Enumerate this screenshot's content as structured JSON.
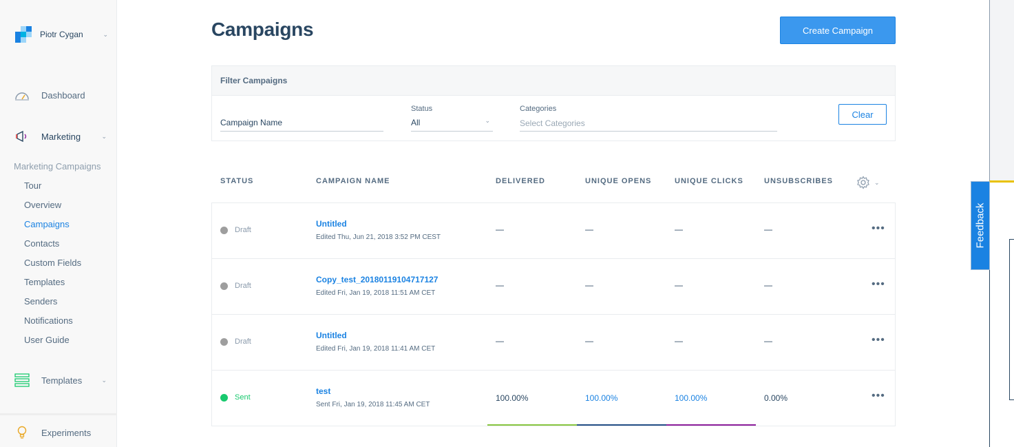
{
  "account": {
    "name": "Piotr Cygan"
  },
  "nav": {
    "dashboard": "Dashboard",
    "marketing": "Marketing",
    "templates": "Templates",
    "experiments": "Experiments"
  },
  "marketing_sub": {
    "heading": "Marketing Campaigns",
    "items": [
      "Tour",
      "Overview",
      "Campaigns",
      "Contacts",
      "Custom Fields",
      "Templates",
      "Senders",
      "Notifications",
      "User Guide"
    ],
    "active": "Campaigns"
  },
  "page": {
    "title": "Campaigns",
    "create_button": "Create Campaign"
  },
  "filter": {
    "heading": "Filter Campaigns",
    "campaign_name_placeholder": "Campaign Name",
    "status_label": "Status",
    "status_value": "All",
    "categories_label": "Categories",
    "categories_placeholder": "Select Categories",
    "clear_button": "Clear"
  },
  "table": {
    "columns": [
      "STATUS",
      "CAMPAIGN NAME",
      "DELIVERED",
      "UNIQUE OPENS",
      "UNIQUE CLICKS",
      "UNSUBSCRIBES"
    ],
    "rows": [
      {
        "status": "Draft",
        "name": "Untitled",
        "date": "Edited Thu, Jun 21, 2018 3:52 PM CEST",
        "delivered": "—",
        "opens": "—",
        "clicks": "—",
        "unsubs": "—"
      },
      {
        "status": "Draft",
        "name": "Copy_test_20180119104717127",
        "date": "Edited Fri, Jan 19, 2018 11:51 AM CET",
        "delivered": "—",
        "opens": "—",
        "clicks": "—",
        "unsubs": "—"
      },
      {
        "status": "Draft",
        "name": "Untitled",
        "date": "Edited Fri, Jan 19, 2018 11:41 AM CET",
        "delivered": "—",
        "opens": "—",
        "clicks": "—",
        "unsubs": "—"
      },
      {
        "status": "Sent",
        "name": "test",
        "date": "Sent Fri, Jan 19, 2018 11:45 AM CET",
        "delivered": "100.00%",
        "opens": "100.00%",
        "clicks": "100.00%",
        "unsubs": "0.00%"
      }
    ]
  },
  "feedback": {
    "label": "Feedback"
  },
  "colors": {
    "accent": "#1a82e2",
    "draft_dot": "#9e9e9e",
    "sent_dot": "#18c96e",
    "delivered_bar": "#87c540",
    "opens_bar": "#244f87",
    "clicks_bar": "#8d1e9b"
  }
}
